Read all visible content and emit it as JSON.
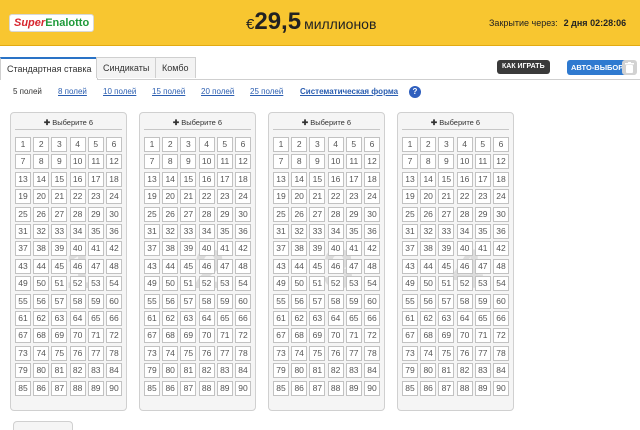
{
  "header": {
    "logo_part1": "Super",
    "logo_part2": "Enalotto",
    "currency": "€",
    "jackpot_amount": "29,5",
    "jackpot_unit": "миллионов",
    "closing_label": "Закрытие через:",
    "closing_value": "2 дня 02:28:06"
  },
  "tabs": [
    {
      "label": "Стандартная ставка",
      "active": true
    },
    {
      "label": "Синдикаты",
      "active": false
    },
    {
      "label": "Комбо",
      "active": false
    }
  ],
  "actions": {
    "how_to_play": "КАК ИГРАТЬ",
    "auto_pick": "АВТО-ВЫБОР",
    "trash_icon": "trash-icon"
  },
  "field_options": [
    {
      "label": "5 полей",
      "current": true
    },
    {
      "label": "8 полей",
      "current": false
    },
    {
      "label": "10 полей",
      "current": false
    },
    {
      "label": "15 полей",
      "current": false
    },
    {
      "label": "20 полей",
      "current": false
    },
    {
      "label": "25 полей",
      "current": false
    },
    {
      "label": "Систематическая форма",
      "current": false,
      "system": true
    }
  ],
  "help_label": "?",
  "panels": [
    {
      "pick_label": "Выберите 6",
      "watermark": "1"
    },
    {
      "pick_label": "Выберите 6",
      "watermark": "2"
    },
    {
      "pick_label": "Выберите 6",
      "watermark": "3"
    },
    {
      "pick_label": "Выберите 6",
      "watermark": "4"
    }
  ],
  "numbers_max": 90,
  "colors": {
    "banner": "#f8c630",
    "accent_blue": "#2f7ad0",
    "link": "#2a5db0"
  }
}
